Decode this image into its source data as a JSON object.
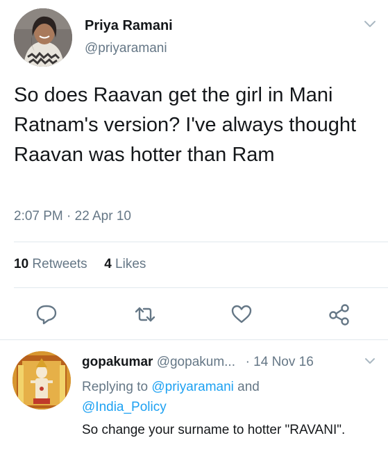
{
  "tweet": {
    "author_name": "Priya Ramani",
    "author_handle": "@priyaramani",
    "text": "So does Raavan get the girl in Mani Ratnam's version? I've always thought Raavan was hotter than Ram",
    "timestamp": "2:07 PM · 22 Apr 10",
    "retweets_count": "10",
    "retweets_label": "Retweets",
    "likes_count": "4",
    "likes_label": "Likes",
    "actions": [
      "reply-icon",
      "retweet-icon",
      "like-icon",
      "share-icon"
    ]
  },
  "reply": {
    "author_name": "gopakumar",
    "author_handle": "@gopakum...",
    "separator": "·",
    "date": "14 Nov 16",
    "replying_prefix": "Replying to",
    "mention_1": "@priyaramani",
    "conjunction": "and",
    "mention_2": "@India_Policy",
    "text": "So change your surname to hotter \"RAVANI\"."
  },
  "colors": {
    "text_primary": "#14171a",
    "text_secondary": "#657786",
    "accent": "#1da1f2",
    "divider": "#e1e8ed"
  }
}
